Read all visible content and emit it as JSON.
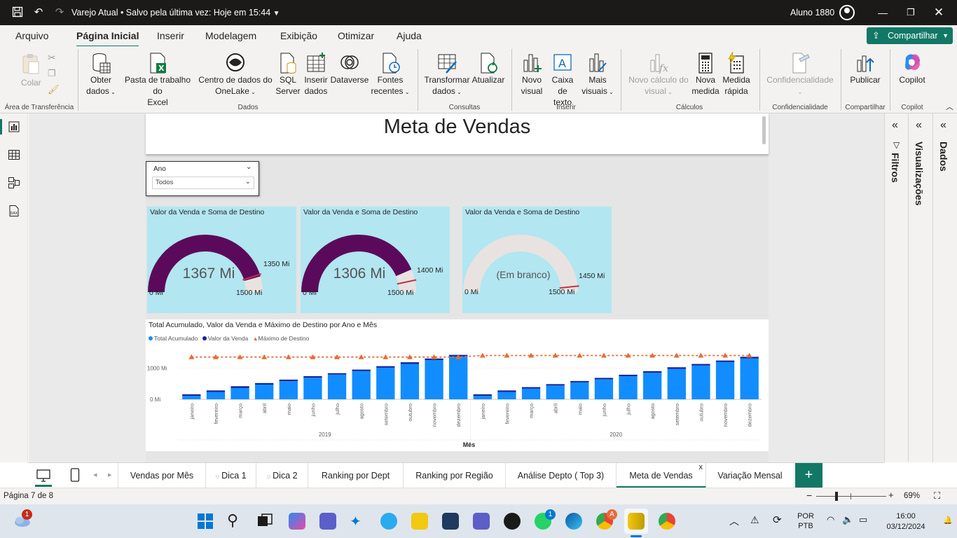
{
  "titlebar": {
    "title": "Varejo Atual • Salvo pela última vez: Hoje em 15:44",
    "user": "Aluno 1880"
  },
  "menu": {
    "tabs": [
      "Arquivo",
      "Página Inicial",
      "Inserir",
      "Modelagem",
      "Exibição",
      "Otimizar",
      "Ajuda"
    ],
    "active": "Página Inicial",
    "share": "Compartilhar"
  },
  "ribbon": {
    "clipboard": {
      "paste": "Colar",
      "group": "Área de Transferência"
    },
    "dados": {
      "obter": [
        "Obter",
        "dados"
      ],
      "excel": [
        "Pasta de trabalho do",
        "Excel"
      ],
      "onelake": [
        "Centro de dados do",
        "OneLake"
      ],
      "sql": [
        "SQL",
        "Server"
      ],
      "inserir": [
        "Inserir",
        "dados"
      ],
      "dataverse": "Dataverse",
      "fontes": [
        "Fontes",
        "recentes"
      ],
      "group": "Dados"
    },
    "consultas": {
      "transformar": [
        "Transformar",
        "dados"
      ],
      "atualizar": "Atualizar",
      "group": "Consultas"
    },
    "inserir": {
      "visual": [
        "Novo",
        "visual"
      ],
      "caixa": [
        "Caixa de",
        "texto"
      ],
      "mais": [
        "Mais",
        "visuais"
      ],
      "group": "Inserir"
    },
    "calculos": {
      "novo_calc": [
        "Novo cálculo do",
        "visual"
      ],
      "medida": [
        "Nova",
        "medida"
      ],
      "rapida": [
        "Medida",
        "rápida"
      ],
      "group": "Cálculos"
    },
    "confidencialidade": {
      "label": "Confidencialidade",
      "group": "Confidencialidade"
    },
    "compartilhar": {
      "publicar": "Publicar",
      "group": "Compartilhar"
    },
    "copilot": {
      "label": "Copilot",
      "group": "Copilot"
    }
  },
  "report": {
    "title": "Meta de Vendas",
    "slicer": {
      "label": "Ano",
      "value": "Todos"
    },
    "gauges": [
      {
        "title": "Valor da Venda e Soma de Destino",
        "value_label": "1367 Mi",
        "value": 1367,
        "min_label": "0 Mi",
        "max_label": "1500 Mi",
        "max": 1500,
        "target_label": "1350 Mi",
        "target": 1350
      },
      {
        "title": "Valor da Venda e Soma de Destino",
        "value_label": "1306 Mi",
        "value": 1306,
        "min_label": "0 Mi",
        "max_label": "1500 Mi",
        "max": 1500,
        "target_label": "1400 Mi",
        "target": 1400
      },
      {
        "title": "Valor da Venda e Soma de Destino",
        "value_label": "(Em branco)",
        "value": 0,
        "min_label": "0 Mi",
        "max_label": "1500 Mi",
        "max": 1500,
        "target_label": "1450 Mi",
        "target": 1450
      }
    ],
    "colors": {
      "gauge_fill": "#5b0a5b",
      "gauge_empty": "#e8e3e0",
      "gauge_bg": "#b2e6f1",
      "target_line": "#c4314b",
      "bar_total": "#118dff",
      "bar_venda": "#12239e",
      "destino": "#e66c37",
      "accent": "#117865"
    }
  },
  "chart_data": {
    "type": "bar",
    "title": "Total Acumulado, Valor da Venda e Máximo de Destino por Ano e Mês",
    "xlabel": "Mês",
    "yticks": [
      "0 Mi",
      "1000 Mi"
    ],
    "ylim": [
      0,
      1500
    ],
    "legend": [
      "Total Acumulado",
      "Valor da Venda",
      "Máximo de Destino"
    ],
    "years": [
      "2019",
      "2020"
    ],
    "categories": [
      "janeiro",
      "fevereiro",
      "março",
      "abril",
      "maio",
      "junho",
      "julho",
      "agosto",
      "setembro",
      "outubro",
      "novembro",
      "dezembro",
      "janeiro",
      "fevereiro",
      "março",
      "abril",
      "maio",
      "junho",
      "julho",
      "agosto",
      "setembro",
      "outubro",
      "novembro",
      "dezembro"
    ],
    "series": [
      {
        "name": "Total Acumulado",
        "values": [
          110,
          230,
          360,
          470,
          580,
          690,
          790,
          900,
          1010,
          1130,
          1250,
          1367,
          110,
          230,
          340,
          440,
          540,
          640,
          740,
          850,
          970,
          1080,
          1190,
          1306
        ]
      },
      {
        "name": "Valor da Venda",
        "values": [
          110,
          120,
          130,
          110,
          110,
          110,
          100,
          110,
          110,
          120,
          120,
          117,
          110,
          120,
          110,
          100,
          100,
          100,
          100,
          110,
          120,
          110,
          110,
          116
        ]
      },
      {
        "name": "Máximo de Destino",
        "values": [
          1350,
          1350,
          1350,
          1350,
          1350,
          1350,
          1350,
          1350,
          1350,
          1350,
          1350,
          1350,
          1400,
          1400,
          1400,
          1400,
          1400,
          1400,
          1400,
          1400,
          1400,
          1400,
          1400,
          1400
        ]
      }
    ]
  },
  "page_tabs": [
    {
      "label": "Vendas por Mês"
    },
    {
      "label": "Dica 1",
      "hidden": true
    },
    {
      "label": "Dica 2",
      "hidden": true
    },
    {
      "label": "Ranking por Dept"
    },
    {
      "label": "Ranking por Região"
    },
    {
      "label": "Análise Depto ( Top 3)"
    },
    {
      "label": "Meta de Vendas",
      "active": true
    },
    {
      "label": "Variação Mensal"
    }
  ],
  "panes": {
    "filtros": "Filtros",
    "visualizacoes": "Visualizações",
    "dados": "Dados"
  },
  "status": {
    "page": "Página 7 de 8",
    "zoom": "69%"
  },
  "taskbar": {
    "badge1": "1",
    "lang": [
      "POR",
      "PTB"
    ],
    "time": "16:00",
    "date": "03/12/2024",
    "whatsapp_badge": "1",
    "chrome_badge": "A"
  }
}
